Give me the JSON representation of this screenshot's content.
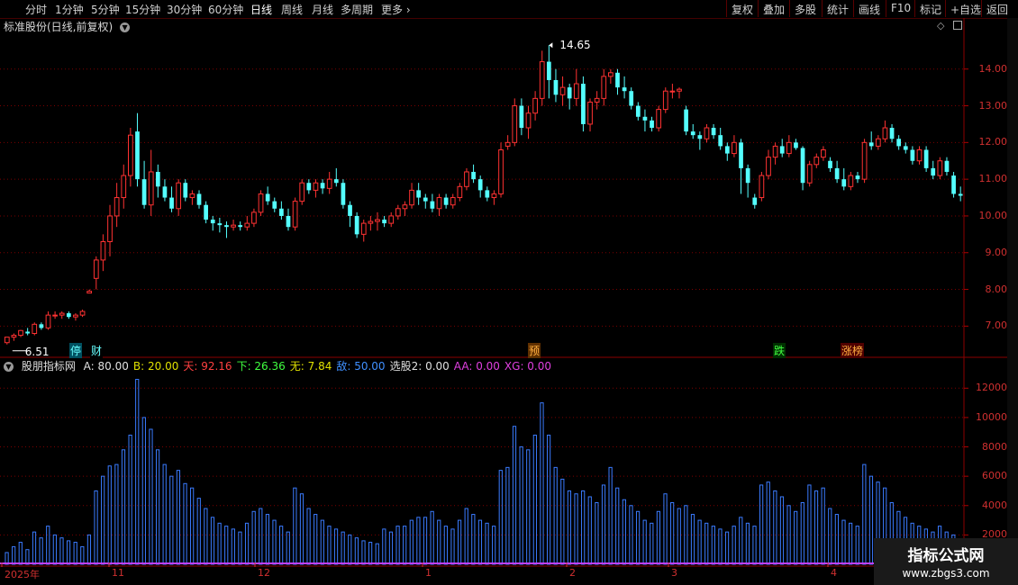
{
  "toolbar": {
    "periods": [
      "分时",
      "1分钟",
      "5分钟",
      "15分钟",
      "30分钟",
      "60分钟",
      "日线",
      "周线",
      "月线",
      "多周期",
      "更多"
    ],
    "active": "日线",
    "right_buttons": [
      "复权",
      "叠加",
      "多股",
      "统计",
      "画线",
      "F10",
      "标记",
      "+自选",
      "返回"
    ]
  },
  "kline": {
    "title": "标准股份(日线,前复权)",
    "high_label": "14.65",
    "low_label": "6.51",
    "price_ticks": [
      "14.00",
      "13.00",
      "12.00",
      "11.00",
      "10.00",
      "9.00",
      "8.00",
      "7.00"
    ],
    "events": [
      "停",
      "财",
      "预",
      "跌",
      "涨榜"
    ]
  },
  "indicator": {
    "name": "股朋指标网",
    "params": [
      {
        "label": "A: 80.00",
        "color": "#e0e0e0"
      },
      {
        "label": "B: 20.00",
        "color": "#e0e000"
      },
      {
        "label": "天: 92.16",
        "color": "#ff4040"
      },
      {
        "label": "下: 26.36",
        "color": "#40ff40"
      },
      {
        "label": "无: 7.84",
        "color": "#e0e000"
      },
      {
        "label": "敌: 50.00",
        "color": "#4090ff"
      },
      {
        "label": "选股2: 0.00",
        "color": "#e0e0e0"
      },
      {
        "label": "AA: 0.00",
        "color": "#e040e0"
      },
      {
        "label": "XG: 0.00",
        "color": "#e040e0"
      }
    ],
    "volume_ticks": [
      "12000",
      "10000",
      "8000",
      "6000",
      "4000",
      "2000"
    ]
  },
  "dates": [
    "2025年",
    "11",
    "12",
    "1",
    "2",
    "3",
    "4"
  ],
  "watermark": {
    "line1": "指标公式网",
    "line2": "www.zbgs3.com"
  },
  "chart_data": {
    "type": "candlestick",
    "up_color": "#ff3232",
    "down_color": "#54ffff",
    "volume_color": "#3a7bff",
    "ylim_price": [
      6.2,
      14.9
    ],
    "ylim_volume": [
      0,
      13000
    ],
    "candles": [
      [
        6.55,
        6.7,
        6.5,
        6.7,
        800
      ],
      [
        6.7,
        6.8,
        6.6,
        6.75,
        1200
      ],
      [
        6.75,
        6.9,
        6.7,
        6.88,
        1500
      ],
      [
        6.85,
        6.95,
        6.75,
        6.8,
        1000
      ],
      [
        6.8,
        7.1,
        6.75,
        7.05,
        2200
      ],
      [
        7.05,
        7.1,
        6.9,
        6.95,
        1800
      ],
      [
        6.95,
        7.4,
        6.9,
        7.3,
        2600
      ],
      [
        7.3,
        7.4,
        7.2,
        7.3,
        2000
      ],
      [
        7.3,
        7.4,
        7.2,
        7.35,
        1800
      ],
      [
        7.35,
        7.4,
        7.2,
        7.25,
        1600
      ],
      [
        7.25,
        7.35,
        7.15,
        7.3,
        1500
      ],
      [
        7.3,
        7.45,
        7.25,
        7.4,
        1200
      ],
      [
        7.9,
        8.0,
        7.9,
        7.95,
        2000
      ],
      [
        8.3,
        8.9,
        8.0,
        8.8,
        5000
      ],
      [
        8.8,
        9.5,
        8.5,
        9.3,
        6000
      ],
      [
        9.3,
        10.3,
        8.9,
        10.0,
        6700
      ],
      [
        10.0,
        10.9,
        9.7,
        10.5,
        6800
      ],
      [
        10.5,
        11.4,
        10.2,
        11.1,
        7800
      ],
      [
        11.1,
        12.4,
        10.8,
        12.2,
        8800
      ],
      [
        12.3,
        12.8,
        10.8,
        11.0,
        12600
      ],
      [
        11.0,
        11.5,
        10.2,
        10.3,
        10000
      ],
      [
        10.3,
        11.8,
        10.0,
        11.2,
        9200
      ],
      [
        11.2,
        11.4,
        10.5,
        10.8,
        7800
      ],
      [
        10.8,
        11.0,
        10.4,
        10.5,
        6800
      ],
      [
        10.5,
        10.8,
        10.1,
        10.2,
        6000
      ],
      [
        10.2,
        11.0,
        10.0,
        10.9,
        6400
      ],
      [
        10.9,
        11.0,
        10.4,
        10.5,
        5500
      ],
      [
        10.5,
        10.7,
        10.3,
        10.6,
        5200
      ],
      [
        10.6,
        10.7,
        10.2,
        10.3,
        4500
      ],
      [
        10.3,
        10.4,
        9.8,
        9.9,
        3800
      ],
      [
        9.9,
        10.0,
        9.6,
        9.8,
        3200
      ],
      [
        9.8,
        9.95,
        9.55,
        9.75,
        2800
      ],
      [
        9.75,
        9.85,
        9.4,
        9.7,
        2600
      ],
      [
        9.7,
        9.9,
        9.6,
        9.75,
        2400
      ],
      [
        9.75,
        9.85,
        9.6,
        9.7,
        2200
      ],
      [
        9.7,
        10.0,
        9.6,
        9.8,
        2800
      ],
      [
        9.8,
        10.2,
        9.7,
        10.1,
        3600
      ],
      [
        10.1,
        10.7,
        10.0,
        10.6,
        3800
      ],
      [
        10.6,
        10.8,
        10.3,
        10.4,
        3400
      ],
      [
        10.4,
        10.5,
        10.1,
        10.2,
        3000
      ],
      [
        10.2,
        10.4,
        9.9,
        10.0,
        2600
      ],
      [
        10.0,
        10.2,
        9.6,
        9.7,
        2200
      ],
      [
        9.7,
        10.5,
        9.6,
        10.4,
        5200
      ],
      [
        10.4,
        11.0,
        10.3,
        10.9,
        4800
      ],
      [
        10.9,
        11.0,
        10.6,
        10.7,
        3800
      ],
      [
        10.7,
        11.0,
        10.5,
        10.9,
        3400
      ],
      [
        10.9,
        11.0,
        10.6,
        10.75,
        3000
      ],
      [
        10.75,
        11.2,
        10.6,
        11.0,
        2600
      ],
      [
        11.0,
        11.3,
        10.8,
        10.9,
        2400
      ],
      [
        10.9,
        11.0,
        10.2,
        10.3,
        2200
      ],
      [
        10.3,
        10.4,
        9.7,
        10.0,
        2000
      ],
      [
        10.0,
        10.1,
        9.4,
        9.5,
        1800
      ],
      [
        9.5,
        9.9,
        9.3,
        9.8,
        1600
      ],
      [
        9.8,
        10.0,
        9.6,
        9.85,
        1500
      ],
      [
        9.85,
        10.1,
        9.6,
        9.9,
        1400
      ],
      [
        9.9,
        10.0,
        9.7,
        9.8,
        2400
      ],
      [
        9.8,
        10.1,
        9.7,
        10.0,
        2200
      ],
      [
        10.0,
        10.3,
        9.9,
        10.2,
        2600
      ],
      [
        10.2,
        10.4,
        10.0,
        10.3,
        2600
      ],
      [
        10.3,
        10.9,
        10.2,
        10.7,
        3000
      ],
      [
        10.7,
        10.9,
        10.3,
        10.5,
        3200
      ],
      [
        10.5,
        10.6,
        10.2,
        10.4,
        3200
      ],
      [
        10.4,
        10.6,
        10.1,
        10.2,
        3600
      ],
      [
        10.2,
        10.6,
        10.0,
        10.5,
        3000
      ],
      [
        10.5,
        10.6,
        10.2,
        10.3,
        2600
      ],
      [
        10.3,
        10.6,
        10.2,
        10.5,
        2400
      ],
      [
        10.5,
        10.9,
        10.4,
        10.8,
        3000
      ],
      [
        10.8,
        11.3,
        10.7,
        11.2,
        3800
      ],
      [
        11.2,
        11.4,
        10.9,
        11.0,
        3400
      ],
      [
        11.0,
        11.1,
        10.5,
        10.7,
        3000
      ],
      [
        10.7,
        10.8,
        10.4,
        10.5,
        2800
      ],
      [
        10.5,
        10.7,
        10.3,
        10.6,
        2600
      ],
      [
        10.6,
        12.0,
        10.5,
        11.8,
        6400
      ],
      [
        11.9,
        12.2,
        11.8,
        12.0,
        6600
      ],
      [
        12.0,
        13.2,
        11.9,
        13.0,
        9400
      ],
      [
        13.0,
        13.2,
        12.2,
        12.4,
        8000
      ],
      [
        12.4,
        13.0,
        12.1,
        12.8,
        7800
      ],
      [
        12.8,
        13.4,
        12.6,
        13.2,
        8800
      ],
      [
        13.2,
        14.5,
        13.0,
        14.2,
        11000
      ],
      [
        14.2,
        14.65,
        13.2,
        13.7,
        8800
      ],
      [
        13.7,
        14.0,
        13.1,
        13.3,
        6600
      ],
      [
        13.3,
        13.8,
        13.0,
        13.5,
        5800
      ],
      [
        13.5,
        13.6,
        12.9,
        13.2,
        5000
      ],
      [
        13.2,
        14.0,
        13.0,
        13.6,
        4800
      ],
      [
        13.6,
        13.8,
        12.3,
        12.5,
        5000
      ],
      [
        12.5,
        13.2,
        12.3,
        13.1,
        4600
      ],
      [
        13.1,
        13.4,
        12.9,
        13.2,
        4200
      ],
      [
        13.2,
        14.0,
        13.0,
        13.8,
        5400
      ],
      [
        13.8,
        14.0,
        13.6,
        13.9,
        6600
      ],
      [
        13.9,
        14.0,
        13.3,
        13.5,
        5200
      ],
      [
        13.5,
        13.8,
        13.2,
        13.4,
        4400
      ],
      [
        13.4,
        13.5,
        12.9,
        13.0,
        4000
      ],
      [
        13.0,
        13.1,
        12.6,
        12.7,
        3600
      ],
      [
        12.7,
        12.9,
        12.3,
        12.6,
        3000
      ],
      [
        12.6,
        12.7,
        12.3,
        12.4,
        2800
      ],
      [
        12.4,
        13.0,
        12.3,
        12.9,
        3600
      ],
      [
        12.9,
        13.5,
        12.8,
        13.4,
        4800
      ],
      [
        13.4,
        13.6,
        13.2,
        13.4,
        4200
      ],
      [
        13.4,
        13.5,
        13.2,
        13.45,
        3800
      ],
      [
        12.9,
        13.0,
        12.2,
        12.3,
        4000
      ],
      [
        12.3,
        12.5,
        12.1,
        12.2,
        3400
      ],
      [
        12.2,
        12.3,
        11.8,
        12.1,
        3000
      ],
      [
        12.1,
        12.5,
        12.0,
        12.4,
        2800
      ],
      [
        12.4,
        12.5,
        12.1,
        12.2,
        2600
      ],
      [
        12.2,
        12.4,
        11.8,
        11.9,
        2400
      ],
      [
        11.9,
        12.0,
        11.5,
        11.7,
        2200
      ],
      [
        11.7,
        12.2,
        11.6,
        12.0,
        2600
      ],
      [
        12.0,
        12.1,
        10.6,
        11.3,
        3200
      ],
      [
        11.3,
        11.4,
        10.5,
        10.9,
        2800
      ],
      [
        10.5,
        10.6,
        10.2,
        10.3,
        2600
      ],
      [
        10.5,
        11.2,
        10.4,
        11.1,
        5400
      ],
      [
        11.1,
        11.8,
        11.0,
        11.6,
        5600
      ],
      [
        11.6,
        12.0,
        11.4,
        11.9,
        5000
      ],
      [
        11.9,
        12.1,
        11.6,
        11.7,
        4600
      ],
      [
        11.7,
        12.2,
        11.6,
        12.0,
        4000
      ],
      [
        12.0,
        12.1,
        11.8,
        11.85,
        3600
      ],
      [
        11.85,
        11.9,
        10.7,
        10.9,
        4200
      ],
      [
        10.9,
        11.5,
        10.8,
        11.4,
        5400
      ],
      [
        11.4,
        11.7,
        11.3,
        11.6,
        5000
      ],
      [
        11.6,
        11.9,
        11.5,
        11.8,
        5200
      ],
      [
        11.5,
        11.6,
        11.2,
        11.3,
        3800
      ],
      [
        11.3,
        11.5,
        10.9,
        11.0,
        3400
      ],
      [
        11.0,
        11.3,
        10.7,
        10.8,
        3000
      ],
      [
        10.8,
        11.2,
        10.7,
        11.1,
        2800
      ],
      [
        11.1,
        11.2,
        10.9,
        11.0,
        2600
      ],
      [
        11.0,
        12.1,
        10.9,
        12.0,
        6800
      ],
      [
        12.0,
        12.3,
        11.8,
        11.9,
        6000
      ],
      [
        11.9,
        12.2,
        11.8,
        12.1,
        5600
      ],
      [
        12.1,
        12.6,
        12.0,
        12.4,
        5200
      ],
      [
        12.4,
        12.5,
        12.0,
        12.1,
        4200
      ],
      [
        12.1,
        12.2,
        11.8,
        11.9,
        3600
      ],
      [
        11.9,
        12.0,
        11.7,
        11.8,
        3200
      ],
      [
        11.8,
        11.9,
        11.4,
        11.5,
        2800
      ],
      [
        11.5,
        11.9,
        11.4,
        11.8,
        2600
      ],
      [
        11.8,
        11.9,
        11.2,
        11.3,
        2400
      ],
      [
        11.3,
        11.5,
        11.0,
        11.1,
        2200
      ],
      [
        11.1,
        11.6,
        11.0,
        11.5,
        2600
      ],
      [
        11.5,
        11.6,
        11.1,
        11.2,
        2200
      ],
      [
        11.1,
        11.2,
        10.5,
        10.6,
        2000
      ],
      [
        10.6,
        10.8,
        10.4,
        10.55,
        1600
      ]
    ]
  }
}
